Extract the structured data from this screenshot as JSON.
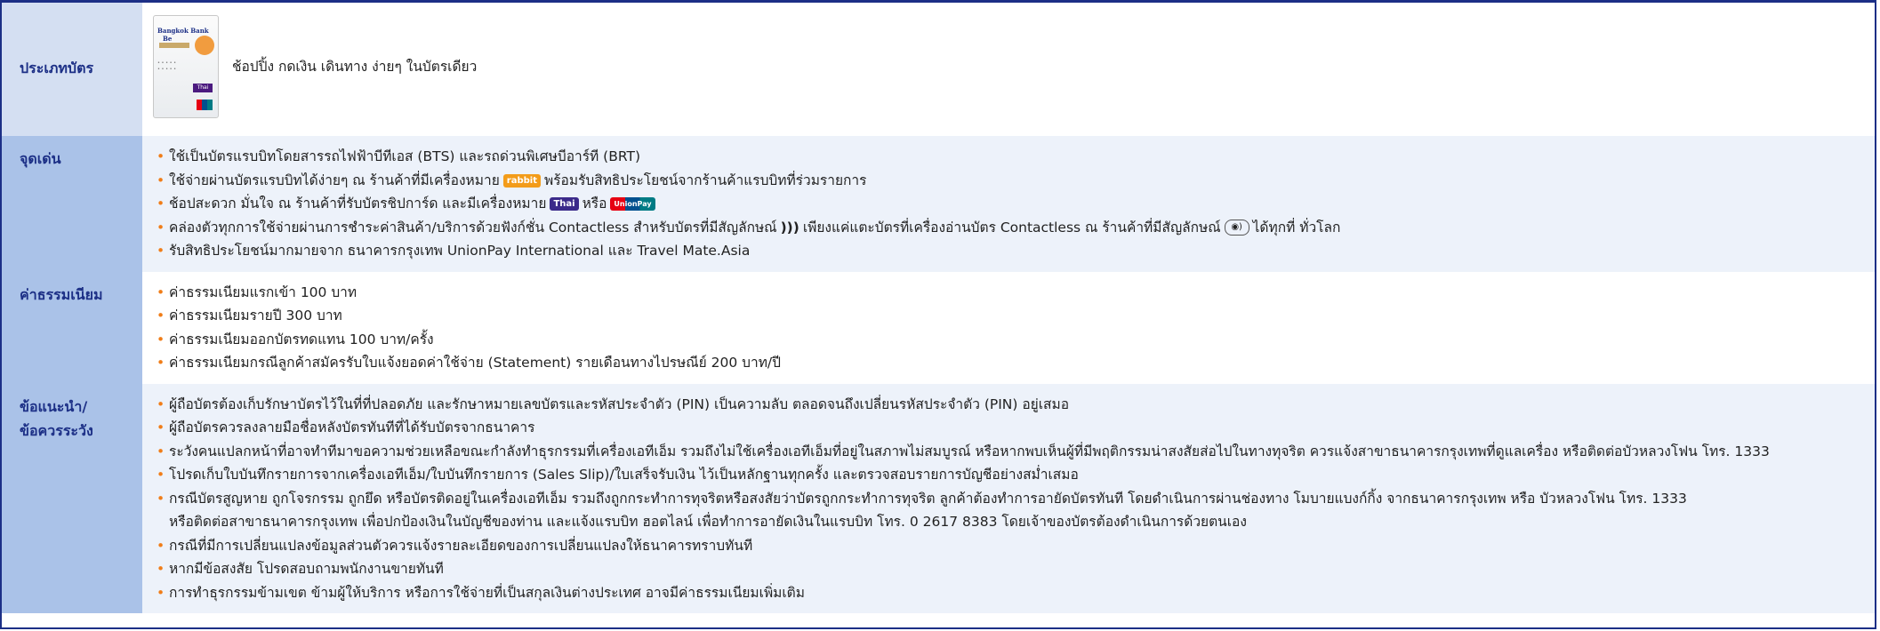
{
  "card_type": {
    "label": "ประเภทบัตร",
    "card_brand": "Bangkok Bank",
    "card_be": "Be",
    "card_thai": "Thai",
    "description": "ช้อปปิ้ง กดเงิน เดินทาง ง่ายๆ ในบัตรเดียว"
  },
  "highlights": {
    "label": "จุดเด่น",
    "items": [
      {
        "text": "ใช้เป็นบัตรแรบบิทโดยสารรถไฟฟ้าบีทีเอส (BTS) และรถด่วนพิเศษบีอาร์ที (BRT)"
      },
      {
        "pre": "ใช้จ่ายผ่านบัตรแรบบิทได้ง่ายๆ ณ ร้านค้าที่มีเครื่องหมาย",
        "badge": "rabbit",
        "post": "พร้อมรับสิทธิประโยชน์จากร้านค้าแรบบิทที่ร่วมรายการ"
      },
      {
        "pre": "ช้อปสะดวก มั่นใจ ณ ร้านค้าที่รับบัตรชิปการ์ด และมีเครื่องหมาย",
        "badge": "Thai",
        "mid": "หรือ",
        "badge2": "UnionPay"
      },
      {
        "pre": "คล่องตัวทุกการใช้จ่ายผ่านการชำระค่าสินค้า/บริการด้วยฟังก์ชั่น Contactless สำหรับบัตรที่มีสัญลักษณ์",
        "wave": ")))",
        "mid": "เพียงแค่แตะบัตรที่เครื่องอ่านบัตร Contactless ณ ร้านค้าที่มีสัญลักษณ์",
        "post": "ได้ทุกที่  ทั่วโลก"
      },
      {
        "text": "รับสิทธิประโยชน์มากมายจาก ธนาคารกรุงเทพ UnionPay International และ Travel Mate.Asia"
      }
    ]
  },
  "fees": {
    "label": "ค่าธรรมเนียม",
    "items": [
      "ค่าธรรมเนียมแรกเข้า 100 บาท",
      "ค่าธรรมเนียมรายปี 300 บาท",
      "ค่าธรรมเนียมออกบัตรทดแทน 100 บาท/ครั้ง",
      "ค่าธรรมเนียมกรณีลูกค้าสมัครรับใบแจ้งยอดค่าใช้จ่าย (Statement) รายเดือนทางไปรษณีย์ 200 บาท/ปี"
    ]
  },
  "advice": {
    "label_line1": "ข้อแนะนำ/",
    "label_line2": "ข้อควรระวัง",
    "items": [
      [
        "ผู้ถือบัตรต้องเก็บรักษาบัตรไว้ในที่ที่ปลอดภัย และรักษาหมายเลขบัตรและรหัสประจำตัว (PIN) เป็นความลับ ตลอดจนถึงเปลี่ยนรหัสประจำตัว (PIN) อยู่เสมอ"
      ],
      [
        "ผู้ถือบัตรควรลงลายมือชื่อหลังบัตรทันทีที่ได้รับบัตรจากธนาคาร"
      ],
      [
        "ระวังคนแปลกหน้าที่อาจทำทีมาขอความช่วยเหลือขณะกำลังทำธุรกรรมที่เครื่องเอทีเอ็ม รวมถึงไม่ใช้เครื่องเอทีเอ็มที่อยู่ในสภาพไม่สมบูรณ์ หรือหากพบเห็นผู้ที่มีพฤติกรรมน่าสงสัยส่อไปในทางทุจริต ควรแจ้งสาขาธนาคารกรุงเทพที่ดูแลเครื่อง หรือติดต่อบัวหลวงโฟน โทร. 1333"
      ],
      [
        "โปรดเก็บใบบันทึกรายการจากเครื่องเอทีเอ็ม/ใบบันทึกรายการ (Sales Slip)/ใบเสร็จรับเงิน ไว้เป็นหลักฐานทุกครั้ง และตรวจสอบรายการบัญชีอย่างสม่ำเสมอ"
      ],
      [
        "กรณีบัตรสูญหาย ถูกโจรกรรม ถูกยึด หรือบัตรติดอยู่ในเครื่องเอทีเอ็ม รวมถึงถูกกระทำการทุจริตหรือสงสัยว่าบัตรถูกกระทำการทุจริต ลูกค้าต้องทำการอายัดบัตรทันที โดยดำเนินการผ่านช่องทาง โมบายแบงก์กิ้ง จากธนาคารกรุงเทพ หรือ บัวหลวงโฟน โทร. 1333",
        "หรือติดต่อสาขาธนาคารกรุงเทพ เพื่อปกป้องเงินในบัญชีของท่าน และแจ้งแรบบิท ฮอตไลน์ เพื่อทำการอายัดเงินในแรบบิท โทร. 0 2617 8383 โดยเจ้าของบัตรต้องดำเนินการด้วยตนเอง"
      ],
      [
        "กรณีที่มีการเปลี่ยนแปลงข้อมูลส่วนตัวควรแจ้งรายละเอียดของการเปลี่ยนแปลงให้ธนาคารทราบทันที"
      ],
      [
        "หากมีข้อสงสัย โปรดสอบถามพนักงานขายทันที"
      ],
      [
        "การทำธุรกรรมข้ามเขต ข้ามผู้ให้บริการ หรือการใช้จ่ายที่เป็นสกุลเงินต่างประเทศ อาจมีค่าธรรมเนียมเพิ่มเติม"
      ]
    ]
  }
}
